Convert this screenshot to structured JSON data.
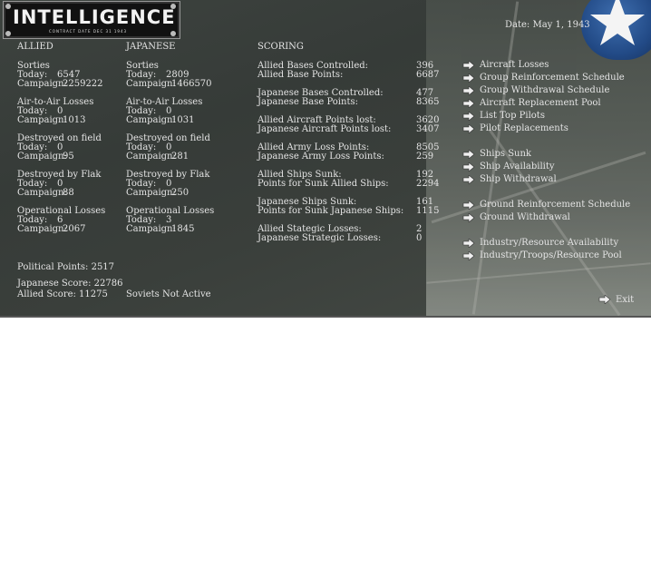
{
  "banner": {
    "title": "INTELLIGENCE",
    "subtitle": "CONTRACT DATE DEC 31 1943"
  },
  "date": "Date: May 1, 1943",
  "allied": {
    "header": "ALLIED",
    "sorties": {
      "label": "Sorties",
      "today": "Today:",
      "today_val": "6547",
      "campaign": "Campaign:",
      "campaign_val": "2259222"
    },
    "air_to_air": {
      "label": "Air-to-Air Losses",
      "today": "Today:",
      "today_val": "0",
      "campaign": "Campaign:",
      "campaign_val": "1013"
    },
    "destroyed_field": {
      "label": "Destroyed on field",
      "today": "Today:",
      "today_val": "0",
      "campaign": "Campaign:",
      "campaign_val": "95"
    },
    "destroyed_flak": {
      "label": "Destroyed by Flak",
      "today": "Today:",
      "today_val": "0",
      "campaign": "Campaign:",
      "campaign_val": "88"
    },
    "operational": {
      "label": "Operational Losses",
      "today": "Today:",
      "today_val": "6",
      "campaign": "Campaign:",
      "campaign_val": "2067"
    }
  },
  "japanese": {
    "header": "JAPANESE",
    "sorties": {
      "label": "Sorties",
      "today": "Today:",
      "today_val": "2809",
      "campaign": "Campaign:",
      "campaign_val": "1466570"
    },
    "air_to_air": {
      "label": "Air-to-Air Losses",
      "today": "Today:",
      "today_val": "0",
      "campaign": "Campaign:",
      "campaign_val": "1031"
    },
    "destroyed_field": {
      "label": "Destroyed on field",
      "today": "Today:",
      "today_val": "0",
      "campaign": "Campaign:",
      "campaign_val": "281"
    },
    "destroyed_flak": {
      "label": "Destroyed by Flak",
      "today": "Today:",
      "today_val": "0",
      "campaign": "Campaign:",
      "campaign_val": "250"
    },
    "operational": {
      "label": "Operational Losses",
      "today": "Today:",
      "today_val": "3",
      "campaign": "Campaign:",
      "campaign_val": "1845"
    }
  },
  "scoring": {
    "header": "SCORING",
    "rows": [
      {
        "label": "Allied Bases Controlled:",
        "value": "396"
      },
      {
        "label": "Allied Base Points:",
        "value": "6687"
      },
      {
        "label": "Japanese Bases Controlled:",
        "value": "477"
      },
      {
        "label": "Japanese Base Points:",
        "value": "8365"
      },
      {
        "label": "Allied Aircraft Points lost:",
        "value": "3620"
      },
      {
        "label": "Japanese Aircraft Points lost:",
        "value": "3407"
      },
      {
        "label": "Allied Army Loss Points:",
        "value": "8505"
      },
      {
        "label": "Japanese Army Loss Points:",
        "value": "259"
      },
      {
        "label": "Allied Ships Sunk:",
        "value": "192"
      },
      {
        "label": "Points for Sunk Allied Ships:",
        "value": "2294"
      },
      {
        "label": "Japanese Ships Sunk:",
        "value": "161"
      },
      {
        "label": "Points for Sunk Japanese Ships:",
        "value": "1115"
      },
      {
        "label": "Allied Stategic Losses:",
        "value": "2"
      },
      {
        "label": "Japanese Strategic Losses:",
        "value": "0"
      }
    ]
  },
  "political": "Political Points:  2517",
  "japanese_score": "Japanese Score:  22786",
  "allied_score": "Allied Score:  11275",
  "soviets": "Soviets Not Active",
  "menu": [
    "Aircraft Losses",
    "Group Reinforcement Schedule",
    "Group Withdrawal Schedule",
    "Aircraft Replacement Pool",
    "List Top Pilots",
    "Pilot Replacements",
    "Ships Sunk",
    "Ship Availability",
    "Ship Withdrawal",
    "Ground Reinforcement Schedule",
    "Ground Withdrawal",
    "Industry/Resource Availability",
    "Industry/Troops/Resource Pool"
  ],
  "exit": "Exit",
  "icons": {
    "menu_arrow": "hand-pointer-arrow-icon",
    "emblem": "star-roundel-icon"
  },
  "colors": {
    "background": "#3a3f3b",
    "text": "#e4e4e4",
    "banner": "#111111"
  }
}
